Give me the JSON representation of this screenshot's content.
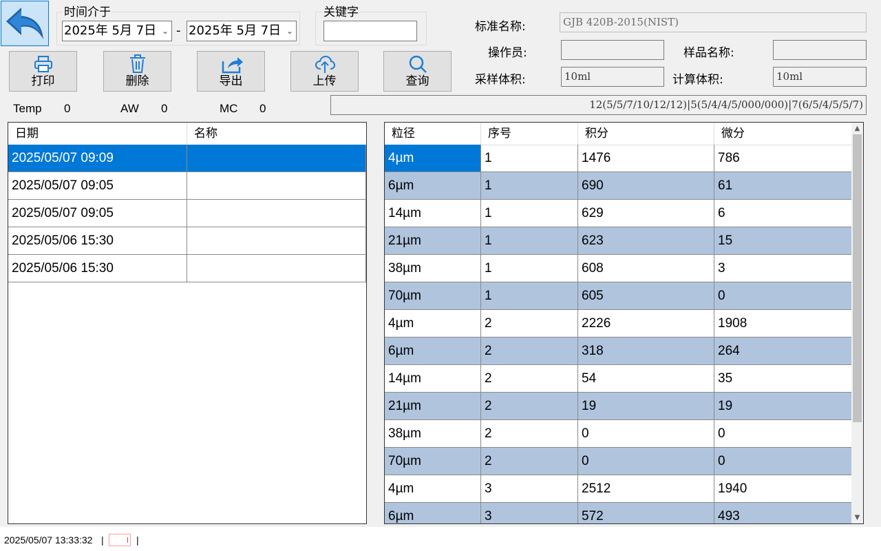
{
  "filters": {
    "time_range_label": "时间介于",
    "date_from": "2025年  5月  7日",
    "date_separator": "-",
    "date_to": "2025年  5月  7日",
    "keyword_label": "关键字",
    "keyword_value": ""
  },
  "info": {
    "standard_label": "标准名称:",
    "standard_value": "GJB 420B-2015(NIST)",
    "operator_label": "操作员:",
    "operator_value": "",
    "sample_name_label": "样品名称:",
    "sample_name_value": "",
    "sample_volume_label": "采样体积:",
    "sample_volume_value": "10ml",
    "calc_volume_label": "计算体积:",
    "calc_volume_value": "10ml",
    "grade_summary": "12(5/5/7/10/12/12)|5(5/4/4/5/000/000)|7(6/5/4/5/5/7)"
  },
  "toolbar": {
    "print": "打印",
    "delete": "删除",
    "export": "导出",
    "upload": "上传",
    "query": "查询"
  },
  "stats": [
    {
      "label": "Temp",
      "value": "0"
    },
    {
      "label": "AW",
      "value": "0"
    },
    {
      "label": "MC",
      "value": "0"
    }
  ],
  "records": {
    "columns": [
      "日期",
      "名称"
    ],
    "rows": [
      [
        "2025/05/07 09:09",
        ""
      ],
      [
        "2025/05/07 09:05",
        ""
      ],
      [
        "2025/05/07 09:05",
        ""
      ],
      [
        "2025/05/06 15:30",
        ""
      ],
      [
        "2025/05/06 15:30",
        ""
      ]
    ]
  },
  "particles": {
    "columns": [
      "粒径",
      "序号",
      "积分",
      "微分"
    ],
    "rows": [
      [
        "4µm",
        "1",
        "1476",
        "786"
      ],
      [
        "6µm",
        "1",
        "690",
        "61"
      ],
      [
        "14µm",
        "1",
        "629",
        "6"
      ],
      [
        "21µm",
        "1",
        "623",
        "15"
      ],
      [
        "38µm",
        "1",
        "608",
        "3"
      ],
      [
        "70µm",
        "1",
        "605",
        "0"
      ],
      [
        "4µm",
        "2",
        "2226",
        "1908"
      ],
      [
        "6µm",
        "2",
        "318",
        "264"
      ],
      [
        "14µm",
        "2",
        "54",
        "35"
      ],
      [
        "21µm",
        "2",
        "19",
        "19"
      ],
      [
        "38µm",
        "2",
        "0",
        "0"
      ],
      [
        "70µm",
        "2",
        "0",
        "0"
      ],
      [
        "4µm",
        "3",
        "2512",
        "1940"
      ],
      [
        "6µm",
        "3",
        "572",
        "493"
      ]
    ]
  },
  "statusbar": {
    "datetime": "2025/05/07 13:33:32",
    "sep1": "|",
    "sep2": "|"
  },
  "colors": {
    "selection": "#0078d7",
    "alt_row": "#b0c4de",
    "icon_blue": "#1c7ed6"
  }
}
